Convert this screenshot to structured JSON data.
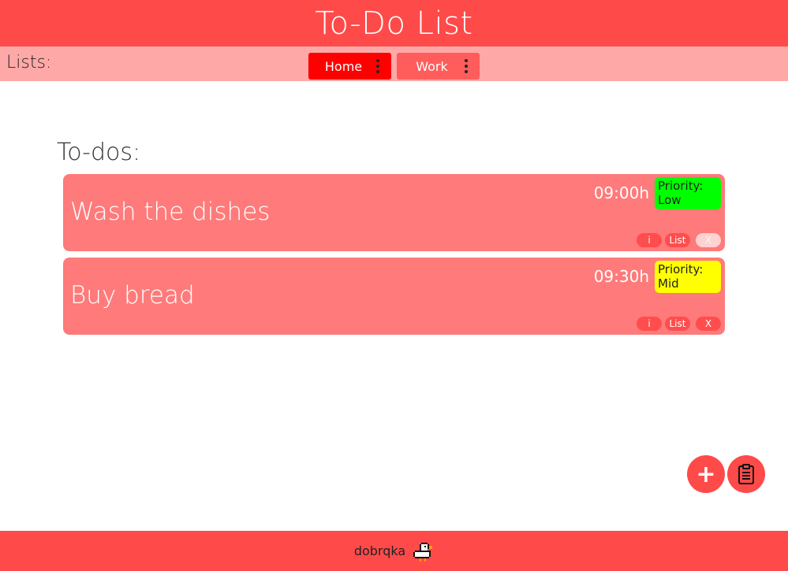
{
  "header": {
    "title": "To-Do List"
  },
  "lists_bar": {
    "label": "Lists:",
    "tabs": [
      {
        "label": "Home",
        "active": true
      },
      {
        "label": "Work",
        "active": false
      }
    ]
  },
  "todos": {
    "title": "To-dos:",
    "items": [
      {
        "title": "Wash the dishes",
        "time": "09:00h",
        "priority_label": "Priority:",
        "priority_value": "Low",
        "priority_color": "#00ff00"
      },
      {
        "title": "Buy bread",
        "time": "09:30h",
        "priority_label": "Priority:",
        "priority_value": "Mid",
        "priority_color": "#ffff00"
      }
    ],
    "actions": {
      "info": "i",
      "list": "List",
      "delete": "X"
    }
  },
  "fabs": {
    "add": "+",
    "clipboard_icon": "clipboard-icon"
  },
  "footer": {
    "author": "dobrqka",
    "logo_icon": "duck-pixel-icon"
  },
  "colors": {
    "brand": "#ff4a4a",
    "lists_bar": "#ffa8a8",
    "active_tab": "#ff0000",
    "card": "#ff7a7a"
  }
}
